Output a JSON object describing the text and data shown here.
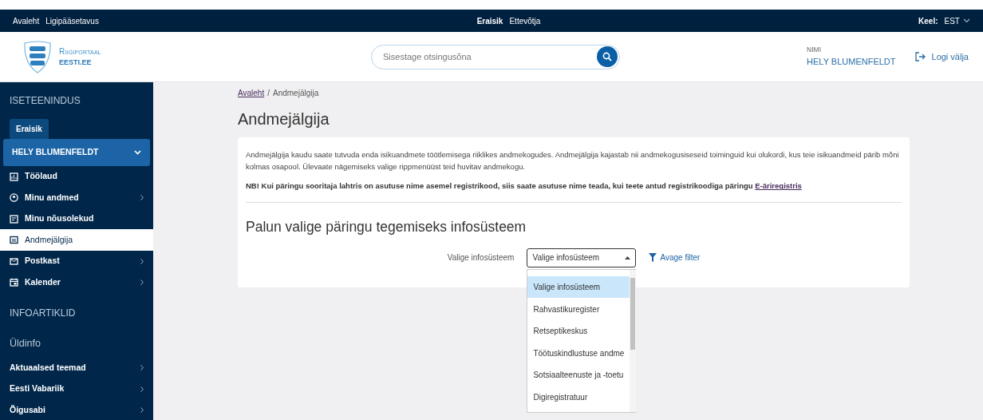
{
  "top_bar": {
    "links": [
      "Avaleht",
      "Ligipääsetavus"
    ],
    "audience_tabs": [
      {
        "label": "Eraisik",
        "selected": true
      },
      {
        "label": "Ettevõtja",
        "selected": false
      }
    ],
    "language_label": "Keel:",
    "language": "EST"
  },
  "header": {
    "logo_line1": "Riigiportaal",
    "logo_line2": "EESTI.EE",
    "search": {
      "placeholder": "Sisestage otsingusõna"
    },
    "user_label": "NIMI",
    "user_name": "HELY BLUMENFELDT",
    "logout": "Logi välja"
  },
  "sidebar": {
    "section_title": "ISETEENINDUS",
    "role_tab": "Eraisik",
    "account": "HELY BLUMENFELDT",
    "items": [
      {
        "label": "Töölaud",
        "kind": "dashboard",
        "submenu": false,
        "selected": false
      },
      {
        "label": "Minu andmed",
        "kind": "person",
        "submenu": true,
        "selected": false
      },
      {
        "label": "Minu nõusolekud",
        "kind": "consent",
        "submenu": false,
        "selected": false
      },
      {
        "label": "Andmejälgija",
        "kind": "tracker",
        "submenu": false,
        "selected": true
      },
      {
        "label": "Postkast",
        "kind": "mail",
        "submenu": true,
        "selected": false
      },
      {
        "label": "Kalender",
        "kind": "calendar",
        "submenu": true,
        "selected": false
      }
    ],
    "info_title": "INFOARTIKLID",
    "general_title": "Üldinfo",
    "info_items": [
      {
        "label": "Aktuaalsed teemad",
        "submenu": true
      },
      {
        "label": "Eesti Vabariik",
        "submenu": true
      },
      {
        "label": "Õigusabi",
        "submenu": true
      }
    ]
  },
  "breadcrumb": [
    "Avaleht",
    "Andmejälgija"
  ],
  "breadcrumb_separator": "/",
  "page_title": "Andmejälgija",
  "intro": "Andmejälgija kaudu saate tutvuda enda isikuandmete töötlemisega riiklikes andmekogudes. Andmejälgija kajastab nii andmekogusiseseid toiminguid kui olukordi, kus teie isikuandmeid pärib mõni kolmas osapool. Ülevaate nägemiseks valige rippmenüüst teid huvitav andmekogu.",
  "notice": "NB! Kui päringu sooritaja lahtris on asutuse nime asemel registrikood, siis saate asutuse nime teada, kui teete antud registrikoodiga päringu",
  "notice_link": "E-äriregistris",
  "section_title": "Palun valige päringu tegemiseks infosüsteem",
  "select": {
    "label": "Valige infosüsteem",
    "value": "Valige infosüsteem",
    "expanded": true,
    "options": [
      {
        "label": "Valige infosüsteem",
        "selected": true
      },
      {
        "label": "Rahvastikuregister",
        "selected": false
      },
      {
        "label": "Retseptikeskus",
        "selected": false
      },
      {
        "label": "Töötuskindlustuse andme",
        "selected": false
      },
      {
        "label": "Sotsiaalteenuste ja -toetu",
        "selected": false
      },
      {
        "label": "Digiregistratuur",
        "selected": false
      }
    ]
  },
  "filter_link": "Avage filter"
}
